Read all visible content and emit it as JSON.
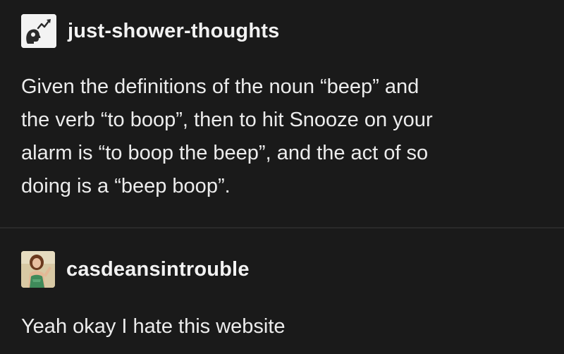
{
  "posts": [
    {
      "username": "just-shower-thoughts",
      "avatar_icon": "rising-graph-head-icon",
      "lines": [
        "Given the definitions of the noun “beep” and",
        "the verb “to boop”, then to hit Snooze on your",
        "alarm is “to boop the beep”, and the act of so",
        "doing is a “beep boop”."
      ]
    },
    {
      "username": "casdeansintrouble",
      "avatar_icon": "portrait-photo-icon",
      "lines": [
        "Yeah okay I hate this website"
      ]
    }
  ],
  "colors": {
    "background": "#1a1a1a",
    "divider": "#2a2a2a",
    "text": "#ececec"
  }
}
